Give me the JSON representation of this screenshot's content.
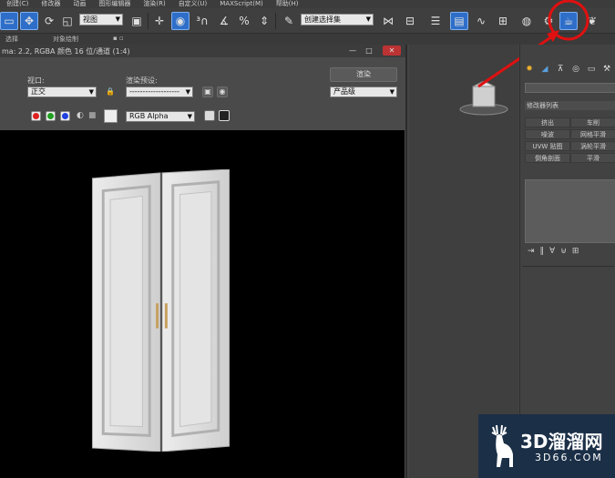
{
  "menubar": {
    "items": [
      "创建(C)",
      "修改器",
      "动画",
      "图形编辑器",
      "渲染(R)",
      "自定义(U)",
      "MAXScript(M)",
      "帮助(H)"
    ]
  },
  "toolbar": {
    "view_select": "视图",
    "selection_set": "创建选择集",
    "highlighted_button": "render-frame-window-icon",
    "accent": "#2e6ec9"
  },
  "substrip": {
    "left_label": "选择",
    "mid_label": "对象绘制"
  },
  "render_window": {
    "title": "ma: 2.2, RGBA 颜色 16 位/通道 (1:4)",
    "viewport_label": "视口:",
    "viewport_value": "正交",
    "preset_label": "渲染预设:",
    "preset_value": "-------------------",
    "render_button": "渲染",
    "product_value": "产品级",
    "channel_value": "RGB Alpha",
    "channel_colors": [
      "#e02020",
      "#20a020",
      "#2040e0"
    ]
  },
  "door": {
    "door_color": "#d9d9d9",
    "handle_color": "#c8a060"
  },
  "command_panel": {
    "modifier_list": "修改器列表",
    "modifiers": [
      "挤出",
      "车削",
      "噪波",
      "网格平滑",
      "UVW 贴图",
      "涡轮平滑",
      "倒角剖面",
      "平滑"
    ]
  },
  "annotation": {
    "color": "#e01010"
  },
  "watermark": {
    "brand": "3D溜溜网",
    "url": "3D66.COM"
  }
}
